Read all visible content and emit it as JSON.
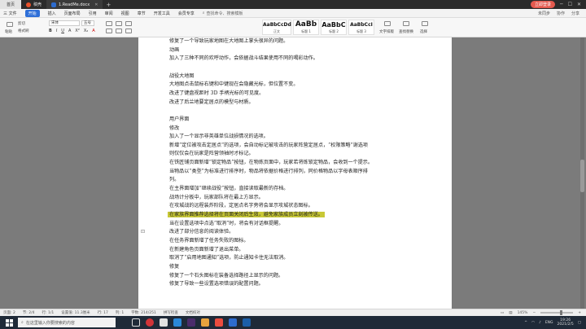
{
  "titlebar": {
    "home_tab": "首页",
    "tabs": [
      {
        "label": "稿壳"
      },
      {
        "label": "1.ReadMe.docx"
      }
    ],
    "login_label": "立即登录",
    "add": "+"
  },
  "menu": {
    "file": "三 文件",
    "items": [
      "开始",
      "插入",
      "页面布局",
      "引用",
      "审阅",
      "视图",
      "章节",
      "开发工具",
      "会员专享"
    ],
    "active_index": 0,
    "search": "查找命令、搜索模板",
    "right": [
      "未同步",
      "协作",
      "分享"
    ]
  },
  "ribbon": {
    "paste": "粘贴",
    "cut": "剪切",
    "format_painter": "格式刷",
    "font": "宋体",
    "size": "五号",
    "format_buttons": [
      "B",
      "I",
      "U",
      "A",
      "X²",
      "X₂",
      "A"
    ],
    "styles": [
      {
        "big": "AaBbCcDd",
        "cap": "正文"
      },
      {
        "big": "AaBb",
        "cap": "标题 1"
      },
      {
        "big": "AaBbC",
        "cap": "标题 2"
      },
      {
        "big": "AaBbCcI",
        "cap": "标题 3"
      }
    ],
    "text_tools": "文字排版",
    "find_replace": "查找替换",
    "select": "选择"
  },
  "document": {
    "lines": [
      "修复了一个导致玩家地图在大地图上掌头很异的问题。",
      "动画",
      "加入了三种不同的欢呼动作，会依据战斗结果使用不同的喝彩动作。",
      "",
      "战役大地图",
      "大地图点击鼠标右键和中键现在会隐藏光标，但位置不变。",
      "改进了键盘视距时 3D 手柄光标的可见度。",
      "改进了后兰地要定居点的模型与材质。",
      "",
      "用户界面",
      "修改",
      "加入了一个显示非英雄单位战损情况的选项。",
      "新增“定位被攻击定居点”的选项，会自动标记被攻击的玩家阵营定居点，“权限策略”谢选项",
      "则仅仅会在玩家是阵营领袖时才标记。",
      "在铁匠铺页面新增“锁定物品”按钮，在物炼页面中，玩家若将炼锁定物品，会收到一个提示。",
      "当物品以“类型”为标准进行排序时，物品将依据价格进行排列，同价格物品以字母表顺序排",
      "列。",
      "在主界面增加“继续战役”按钮，直接读取最新的存档。",
      "战场计分板中，玩家部队将在最上方显示。",
      "在攻城战的远程装炸阶段，定居点名字旁将会显示攻城状态图标。",
      "在家族界面推荐选择将在页面关闭后生效，避免家族成员立刻被传送。",
      "当在设置选项中点选“取消”时，将会有对话框提醒。",
      "改进了部分信息的阅读体验。",
      "在任务界面新增了任务失败的图标。",
      "在新建角色页面新增了退出菜单。",
      "取消了“启用地图通知”选项，防止通知卡住无法取消。",
      "修复",
      "修复了一个石头图标在装备选择路径上显示的问题。",
      "修复了导致一些设置选项错误的配置问题。"
    ],
    "highlight_index": 20
  },
  "status": {
    "left": [
      "页面: 2",
      "节: 2/4",
      "行: 1/1",
      "设置值: 11.3厘米",
      "行: 17",
      "列: 1",
      "字数: 214/251",
      "拼写检查",
      "文档校对"
    ],
    "zoom": "145%"
  },
  "taskbar": {
    "search": "在这里输入你要搜索的内容",
    "lang": "ENG",
    "time": "19:26",
    "date": "2021/2/5"
  },
  "colors": {
    "accent": "#2e6fd8",
    "highlight": "#c8c836",
    "login": "#e45a4f"
  }
}
